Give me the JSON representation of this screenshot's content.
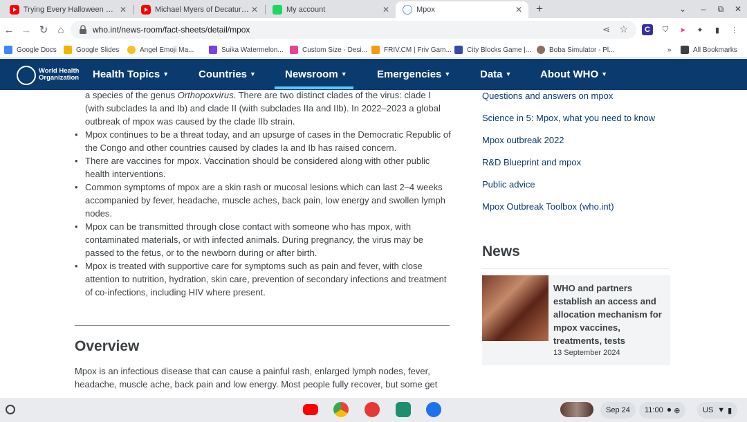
{
  "tabs": [
    {
      "title": "Trying Every Halloween Candy F",
      "favicon": "youtube-icon"
    },
    {
      "title": "Michael Myers of Decatur - YouT",
      "favicon": "youtube-icon"
    },
    {
      "title": "My account",
      "favicon": "account-icon"
    },
    {
      "title": "Mpox",
      "favicon": "who-icon",
      "active": true
    }
  ],
  "url": "who.int/news-room/fact-sheets/detail/mpox",
  "bookmarks": [
    {
      "label": "Google Docs",
      "color": "#4285f4"
    },
    {
      "label": "Google Slides",
      "color": "#f4b400"
    },
    {
      "label": "Angel Emoji Ma...",
      "color": "#f6c026"
    },
    {
      "label": "Suika Watermelon...",
      "color": "#7b3fe4"
    },
    {
      "label": "Custom Size - Desi...",
      "color": "#e84393"
    },
    {
      "label": "FRIV.CM | Friv Gam...",
      "color": "#f39c12"
    },
    {
      "label": "City Blocks Game |...",
      "color": "#3949ab"
    },
    {
      "label": "Boba Simulator - Pl...",
      "color": "#8d6e63"
    }
  ],
  "all_bookmarks": "All Bookmarks",
  "who_logo_text": [
    "World Health",
    "Organization"
  ],
  "nav": [
    {
      "label": "Health Topics"
    },
    {
      "label": "Countries"
    },
    {
      "label": "Newsroom",
      "active": true
    },
    {
      "label": "Emergencies"
    },
    {
      "label": "Data"
    },
    {
      "label": "About WHO"
    }
  ],
  "bullet_continuation": [
    "a species of the genus ",
    "Orthopoxvirus",
    ". There are two distinct clades of the virus: clade I (with subclades Ia and Ib) and clade II (with subclades IIa and IIb). In 2022–2023 a global outbreak of mpox was caused by the clade IIb strain."
  ],
  "bullets": [
    "Mpox continues to be a threat today, and an upsurge of cases in the Democratic Republic of the Congo and other countries caused by clades Ia and Ib has raised concern.",
    "There are vaccines for mpox. Vaccination should be considered along with other public health interventions.",
    "Common symptoms of mpox are a skin rash or mucosal lesions which can last 2–4 weeks accompanied by fever, headache, muscle aches, back pain, low energy and swollen lymph nodes.",
    "Mpox can be transmitted through close contact with someone who has mpox, with contaminated materials, or with infected animals. During pregnancy, the virus may be passed to the fetus, or to the newborn during or after birth.",
    "Mpox is treated with supportive care for symptoms such as pain and fever, with close attention to nutrition, hydration, skin care, prevention of secondary infections and treatment of co-infections, including HIV where present."
  ],
  "overview": {
    "heading": "Overview",
    "text": "Mpox is an infectious disease that can cause a painful rash, enlarged lymph nodes, fever, headache, muscle ache, back pain and low energy. Most people fully recover, but some get"
  },
  "related_links": [
    "Questions and answers on mpox",
    "Science in 5: Mpox, what you need to know",
    "Mpox outbreak 2022",
    "R&D Blueprint and mpox",
    "Public advice",
    "Mpox Outbreak Toolbox (who.int)"
  ],
  "news": {
    "heading": "News",
    "title": "WHO and partners establish an access and allocation mechanism for mpox vaccines, treatments, tests",
    "date": "13 September 2024"
  },
  "shelf": {
    "date": "Sep 24",
    "time": "11:00",
    "ime": "US"
  },
  "colors": {
    "who_navy": "#0b3a6e",
    "accent": "#5ac8fa"
  }
}
